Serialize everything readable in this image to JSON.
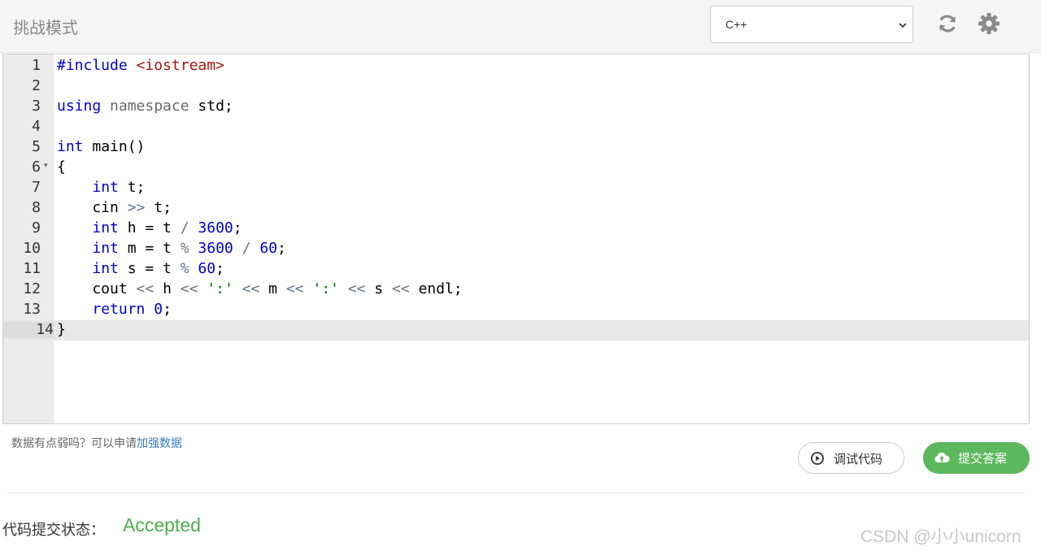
{
  "header": {
    "title": "挑战模式",
    "language_select": {
      "value": "C++"
    },
    "refresh_icon": "refresh-icon",
    "settings_icon": "gear-icon"
  },
  "editor": {
    "active_line": 14,
    "lines": [
      {
        "n": "1",
        "tokens": [
          [
            "kw",
            "#include"
          ],
          [
            "",
            " "
          ],
          [
            "str",
            "<iostream>"
          ]
        ]
      },
      {
        "n": "2",
        "tokens": []
      },
      {
        "n": "3",
        "tokens": [
          [
            "kw",
            "using"
          ],
          [
            "",
            " "
          ],
          [
            "ns",
            "namespace"
          ],
          [
            "",
            " std;"
          ]
        ]
      },
      {
        "n": "4",
        "tokens": []
      },
      {
        "n": "5",
        "tokens": [
          [
            "kw",
            "int"
          ],
          [
            "",
            " main()"
          ]
        ]
      },
      {
        "n": "6",
        "fold": true,
        "tokens": [
          [
            "",
            "{"
          ]
        ]
      },
      {
        "n": "7",
        "tokens": [
          [
            "",
            "    "
          ],
          [
            "kw",
            "int"
          ],
          [
            "",
            " t;"
          ]
        ]
      },
      {
        "n": "8",
        "tokens": [
          [
            "",
            "    cin "
          ],
          [
            "op",
            ">>"
          ],
          [
            "",
            " t;"
          ]
        ]
      },
      {
        "n": "9",
        "tokens": [
          [
            "",
            "    "
          ],
          [
            "kw",
            "int"
          ],
          [
            "",
            " h = t "
          ],
          [
            "op",
            "/"
          ],
          [
            "",
            " "
          ],
          [
            "num",
            "3600"
          ],
          [
            "",
            ";"
          ]
        ]
      },
      {
        "n": "10",
        "tokens": [
          [
            "",
            "    "
          ],
          [
            "kw",
            "int"
          ],
          [
            "",
            " m = t "
          ],
          [
            "op",
            "%"
          ],
          [
            "",
            " "
          ],
          [
            "num",
            "3600"
          ],
          [
            "",
            " "
          ],
          [
            "op",
            "/"
          ],
          [
            "",
            " "
          ],
          [
            "num",
            "60"
          ],
          [
            "",
            ";"
          ]
        ]
      },
      {
        "n": "11",
        "tokens": [
          [
            "",
            "    "
          ],
          [
            "kw",
            "int"
          ],
          [
            "",
            " s = t "
          ],
          [
            "op",
            "%"
          ],
          [
            "",
            " "
          ],
          [
            "num",
            "60"
          ],
          [
            "",
            ";"
          ]
        ]
      },
      {
        "n": "12",
        "tokens": [
          [
            "",
            "    cout "
          ],
          [
            "op",
            "<<"
          ],
          [
            "",
            " h "
          ],
          [
            "op",
            "<<"
          ],
          [
            "",
            " "
          ],
          [
            "chr",
            "':'"
          ],
          [
            "",
            " "
          ],
          [
            "op",
            "<<"
          ],
          [
            "",
            " m "
          ],
          [
            "op",
            "<<"
          ],
          [
            "",
            " "
          ],
          [
            "chr",
            "':'"
          ],
          [
            "",
            " "
          ],
          [
            "op",
            "<<"
          ],
          [
            "",
            " s "
          ],
          [
            "op",
            "<<"
          ],
          [
            "",
            " endl;"
          ]
        ]
      },
      {
        "n": "13",
        "tokens": [
          [
            "",
            "    "
          ],
          [
            "kw",
            "return"
          ],
          [
            "",
            " "
          ],
          [
            "num",
            "0"
          ],
          [
            "",
            ";"
          ]
        ]
      },
      {
        "n": "14",
        "tokens": [
          [
            "",
            "}"
          ]
        ]
      }
    ]
  },
  "footer": {
    "hint_text": "数据有点弱吗？可以申请",
    "hint_link": "加强数据",
    "debug_label": "调试代码",
    "submit_label": "提交答案",
    "status_label": "代码提交状态：",
    "status_value": "Accepted",
    "status_color": "#4cae4c",
    "watermark": "CSDN @小小unicorn"
  }
}
